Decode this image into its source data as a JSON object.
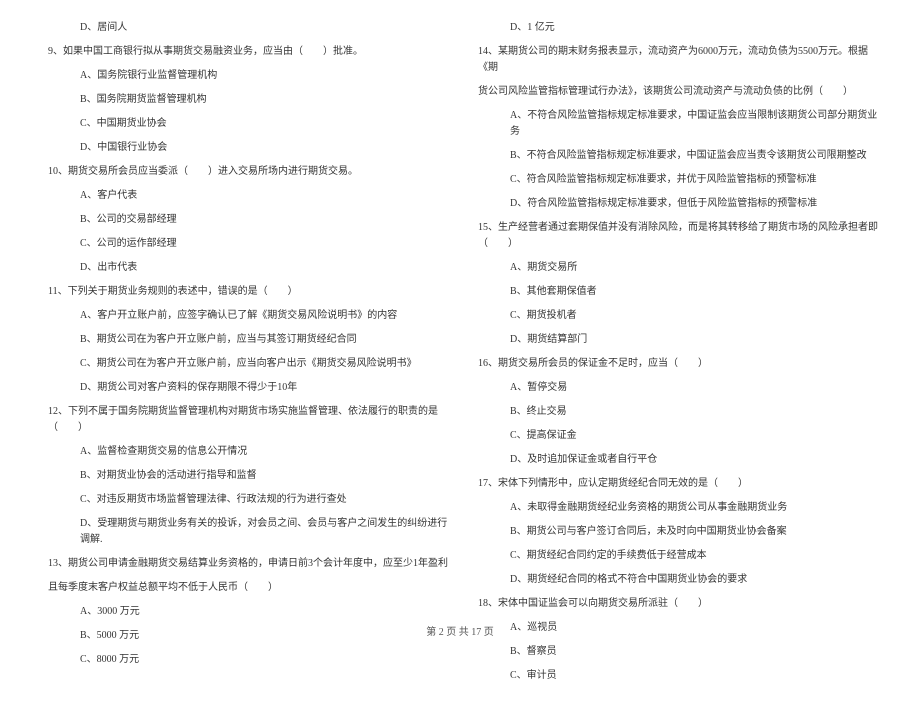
{
  "left_column": [
    {
      "type": "option",
      "text": "D、居间人"
    },
    {
      "type": "question",
      "text": "9、如果中国工商银行拟从事期货交易融资业务，应当由（　　）批准。"
    },
    {
      "type": "option",
      "text": "A、国务院银行业监督管理机构"
    },
    {
      "type": "option",
      "text": "B、国务院期货监督管理机构"
    },
    {
      "type": "option",
      "text": "C、中国期货业协会"
    },
    {
      "type": "option",
      "text": "D、中国银行业协会"
    },
    {
      "type": "question",
      "text": "10、期货交易所会员应当委派（　　）进入交易所场内进行期货交易。"
    },
    {
      "type": "option",
      "text": "A、客户代表"
    },
    {
      "type": "option",
      "text": "B、公司的交易部经理"
    },
    {
      "type": "option",
      "text": "C、公司的运作部经理"
    },
    {
      "type": "option",
      "text": "D、出市代表"
    },
    {
      "type": "question",
      "text": "11、下列关于期货业务规则的表述中，错误的是（　　）"
    },
    {
      "type": "option",
      "text": "A、客户开立账户前，应签字确认已了解《期货交易风险说明书》的内容"
    },
    {
      "type": "option",
      "text": "B、期货公司在为客户开立账户前，应当与其签订期货经纪合同"
    },
    {
      "type": "option",
      "text": "C、期货公司在为客户开立账户前，应当向客户出示《期货交易风险说明书》"
    },
    {
      "type": "option",
      "text": "D、期货公司对客户资料的保存期限不得少于10年"
    },
    {
      "type": "question",
      "text": "12、下列不属于国务院期货监督管理机构对期货市场实施监督管理、依法履行的职责的是（　　）"
    },
    {
      "type": "option",
      "text": "A、监督检查期货交易的信息公开情况"
    },
    {
      "type": "option",
      "text": "B、对期货业协会的活动进行指导和监督"
    },
    {
      "type": "option",
      "text": "C、对违反期货市场监督管理法律、行政法规的行为进行查处"
    },
    {
      "type": "option",
      "text": "D、受理期货与期货业务有关的投诉，对会员之间、会员与客户之间发生的纠纷进行调解."
    },
    {
      "type": "question",
      "text": "13、期货公司申请金融期货交易结算业务资格的，申请日前3个会计年度中，应至少1年盈利"
    },
    {
      "type": "sub-text",
      "text": "且每季度末客户权益总额平均不低于人民币（　　）"
    },
    {
      "type": "option",
      "text": "A、3000 万元"
    },
    {
      "type": "option",
      "text": "B、5000 万元"
    },
    {
      "type": "option",
      "text": "C、8000 万元"
    }
  ],
  "right_column": [
    {
      "type": "option",
      "text": "D、1 亿元"
    },
    {
      "type": "question",
      "text": "14、某期货公司的期末财务报表显示，流动资产为6000万元，流动负债为5500万元。根据《期"
    },
    {
      "type": "sub-text",
      "text": "货公司风险监管指标管理试行办法》，该期货公司流动资产与流动负债的比例（　　）"
    },
    {
      "type": "option",
      "text": "A、不符合风险监管指标规定标准要求，中国证监会应当限制该期货公司部分期货业务"
    },
    {
      "type": "option",
      "text": "B、不符合风险监管指标规定标准要求，中国证监会应当责令该期货公司限期整改"
    },
    {
      "type": "option",
      "text": "C、符合风险监管指标规定标准要求，并优于风险监管指标的预警标准"
    },
    {
      "type": "option",
      "text": "D、符合风险监管指标规定标准要求，但低于风险监管指标的预警标准"
    },
    {
      "type": "question",
      "text": "15、生产经营者通过套期保值并没有消除风险，而是将其转移给了期货市场的风险承担者即（　　）"
    },
    {
      "type": "option",
      "text": "A、期货交易所"
    },
    {
      "type": "option",
      "text": "B、其他套期保值者"
    },
    {
      "type": "option",
      "text": "C、期货投机者"
    },
    {
      "type": "option",
      "text": "D、期货结算部门"
    },
    {
      "type": "question",
      "text": "16、期货交易所会员的保证金不足时，应当（　　）"
    },
    {
      "type": "option",
      "text": "A、暂停交易"
    },
    {
      "type": "option",
      "text": "B、终止交易"
    },
    {
      "type": "option",
      "text": "C、提高保证金"
    },
    {
      "type": "option",
      "text": "D、及时追加保证金或者自行平仓"
    },
    {
      "type": "question",
      "text": "17、宋体下列情形中，应认定期货经纪合同无效的是（　　）"
    },
    {
      "type": "option",
      "text": "A、未取得金融期货经纪业务资格的期货公司从事金融期货业务"
    },
    {
      "type": "option",
      "text": "B、期货公司与客户签订合同后，未及时向中国期货业协会备案"
    },
    {
      "type": "option",
      "text": "C、期货经纪合同约定的手续费低于经营成本"
    },
    {
      "type": "option",
      "text": "D、期货经纪合同的格式不符合中国期货业协会的要求"
    },
    {
      "type": "question",
      "text": "18、宋体中国证监会可以向期货交易所派驻（　　）"
    },
    {
      "type": "option",
      "text": "A、巡视员"
    },
    {
      "type": "option",
      "text": "B、督察员"
    },
    {
      "type": "option",
      "text": "C、审计员"
    }
  ],
  "footer": "第 2 页 共 17 页"
}
